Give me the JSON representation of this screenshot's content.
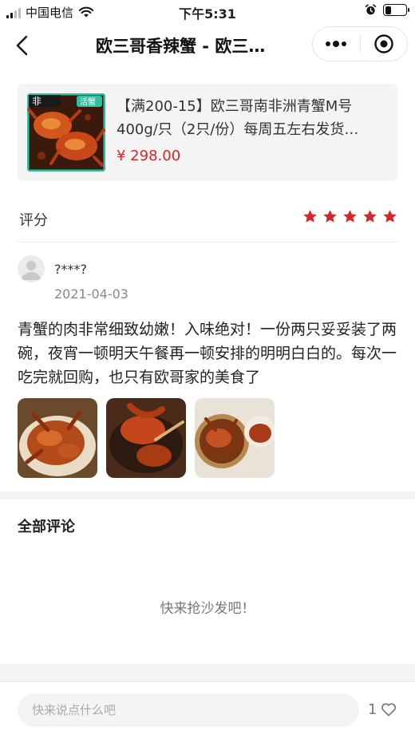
{
  "status_bar": {
    "carrier": "中国电信",
    "time": "下午5:31",
    "battery_level": 0.3
  },
  "nav": {
    "title": "欧三哥香辣蟹 - 欧三…",
    "icons": [
      "back-arrow-icon",
      "more-dots-icon",
      "close-target-icon"
    ]
  },
  "product": {
    "name": "【满200-15】欧三哥南非洲青蟹M号400g/只（2只/份）每周五左右发货…",
    "price": "¥ 298.00",
    "thumb_text": "非",
    "thumb_badge": "活蟹"
  },
  "rating": {
    "label": "评分",
    "stars": 5,
    "max_stars": 5,
    "star_color": "#d7262b"
  },
  "review": {
    "user": "?***?",
    "date": "2021-04-03",
    "text": "青蟹的肉非常细致幼嫩！入味绝对！一份两只妥妥装了两碗，夜宵一顿明天午餐再一顿安排的明明白白的。每次一吃完就回购，也只有欧哥家的美食了",
    "photo_count": 3
  },
  "comments": {
    "header": "全部评论",
    "empty_hint": "快来抢沙发吧！"
  },
  "bottom": {
    "input_placeholder": "快来说点什么吧",
    "like_count": "1",
    "icons": [
      "heart-icon"
    ]
  },
  "colors": {
    "accent_red": "#d7262b",
    "panel_gray": "#f4f4f5"
  }
}
